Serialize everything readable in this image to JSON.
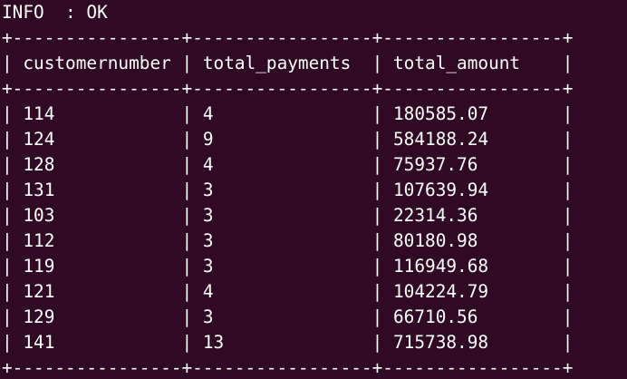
{
  "terminal": {
    "status_line": "INFO  : OK",
    "border_line": "+----------------+-----------------+-----------------+",
    "columns": [
      "customernumber",
      "total_payments",
      "total_amount"
    ],
    "rows": [
      [
        "114",
        "4",
        "180585.07"
      ],
      [
        "124",
        "9",
        "584188.24"
      ],
      [
        "128",
        "4",
        "75937.76"
      ],
      [
        "131",
        "3",
        "107639.94"
      ],
      [
        "103",
        "3",
        "22314.36"
      ],
      [
        "112",
        "3",
        "80180.98"
      ],
      [
        "119",
        "3",
        "116949.68"
      ],
      [
        "121",
        "4",
        "104224.79"
      ],
      [
        "129",
        "3",
        "66710.56"
      ],
      [
        "141",
        "13",
        "715738.98"
      ]
    ]
  },
  "colors": {
    "background": "#300a24",
    "foreground": "#ffffff"
  }
}
